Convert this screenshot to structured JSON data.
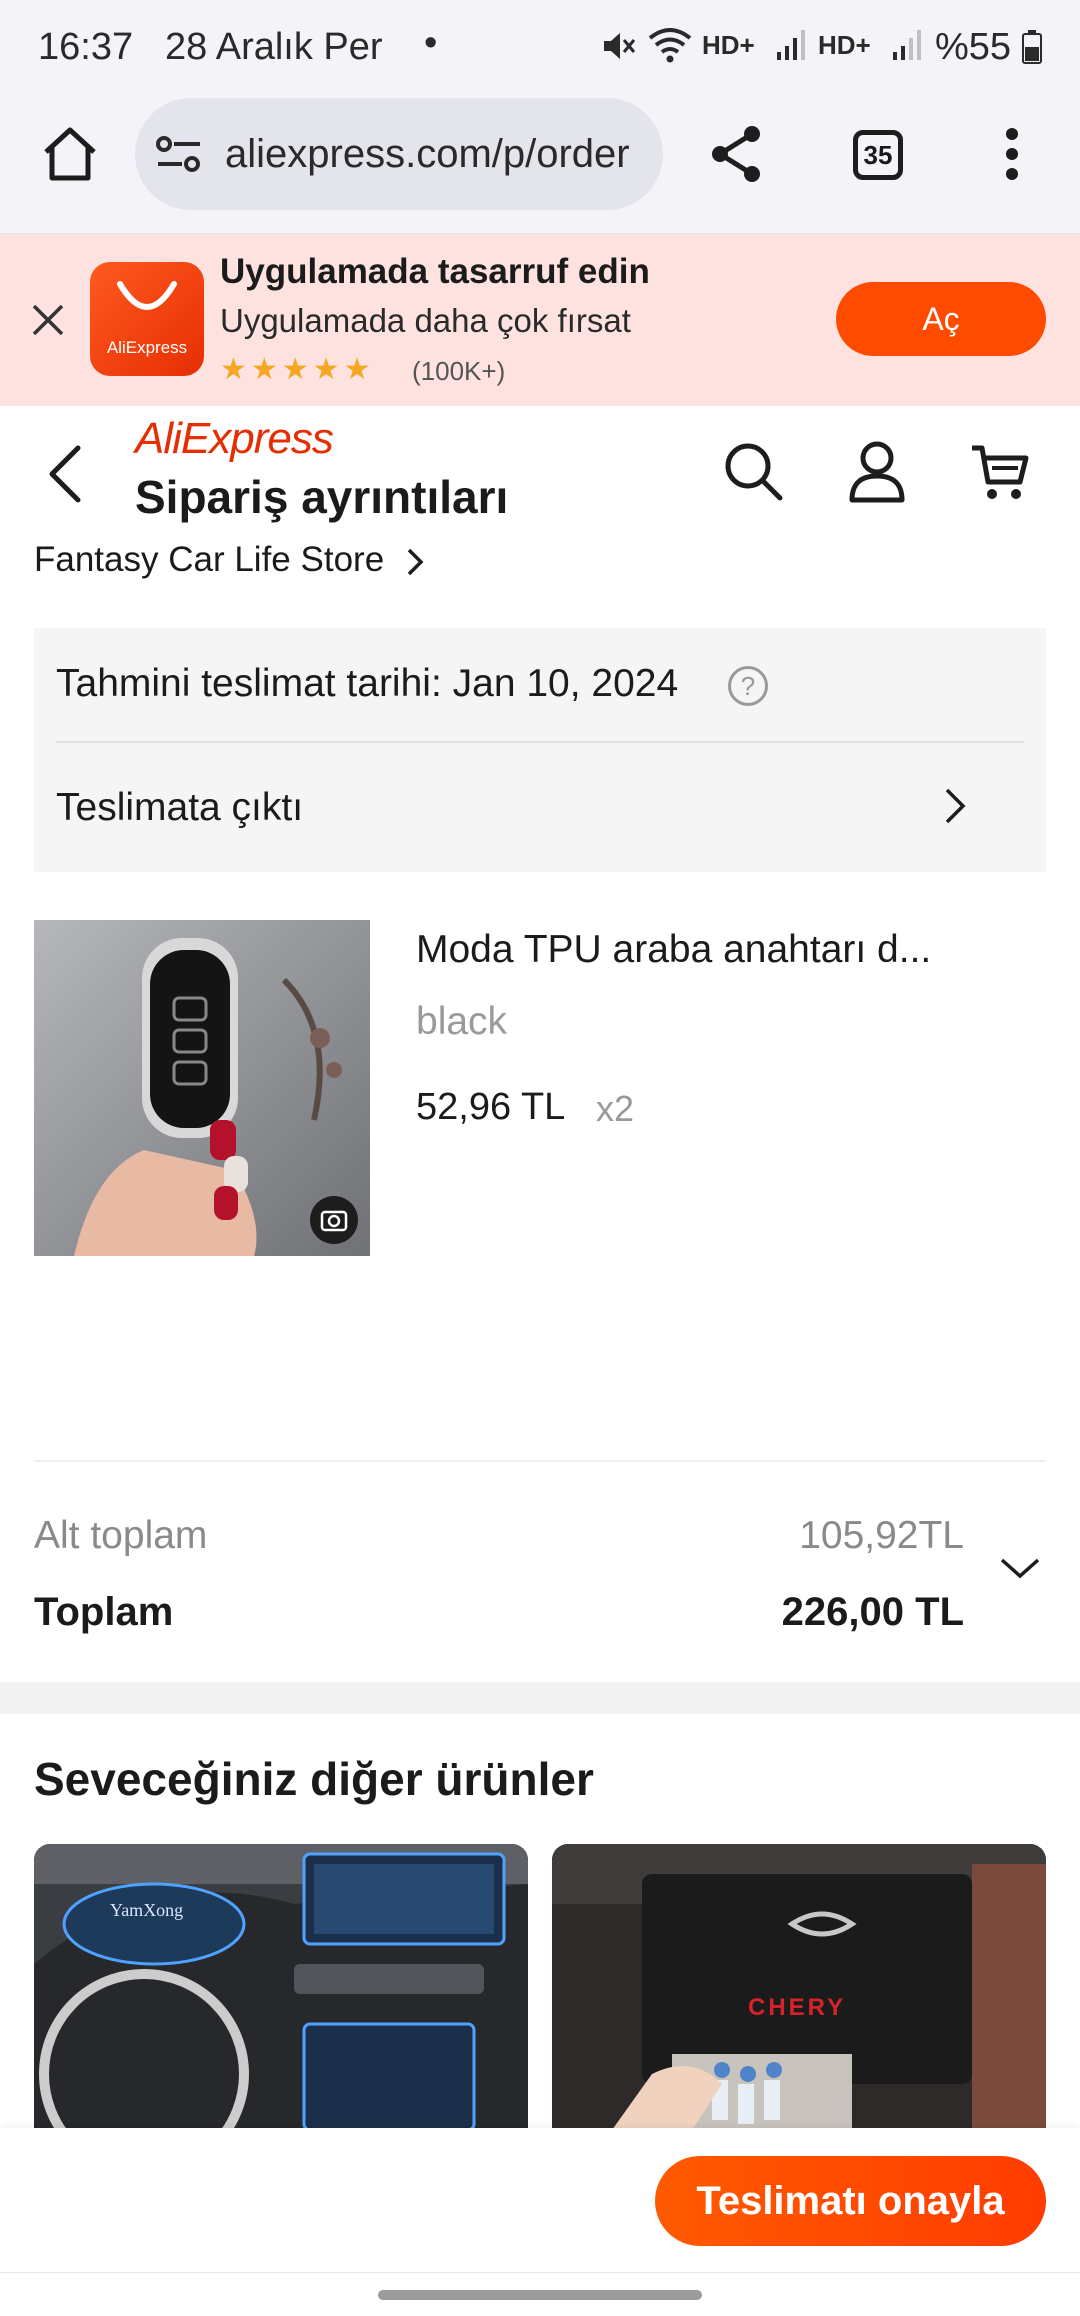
{
  "status_bar": {
    "time": "16:37",
    "date": "28 Aralık Per",
    "dot": "•",
    "network_1": "HD+",
    "network_2": "HD+",
    "battery": "%55"
  },
  "browser": {
    "url": "aliexpress.com/p/order",
    "tab_count": "35"
  },
  "app_banner": {
    "title": "Uygulamada tasarruf edin",
    "subtitle": "Uygulamada daha çok fırsat",
    "stars": "★★★★★",
    "rating_count": "(100K+)",
    "logo_label": "AliExpress",
    "open_label": "Aç"
  },
  "header": {
    "logo": "AliExpress",
    "title": "Sipariş ayrıntıları",
    "store_name": "Fantasy Car Life Store"
  },
  "delivery": {
    "estimated_date": "Tahmini teslimat tarihi: Jan 10, 2024",
    "help": "?",
    "status": "Teslimata çıktı"
  },
  "product": {
    "name": "Moda TPU araba anahtarı d...",
    "variant": "black",
    "price": "52,96 TL",
    "quantity": "x2"
  },
  "totals": {
    "subtotal_label": "Alt toplam",
    "subtotal_value": "105,92TL",
    "total_label": "Toplam",
    "total_value": "226,00 TL"
  },
  "recommendations": {
    "title": "Seveceğiniz diğer ürünler",
    "card_1_watermark": "YamXong",
    "card_2_brand": "CHERY"
  },
  "actions": {
    "confirm_delivery": "Teslimatı onayla"
  },
  "colors": {
    "brand": "#e62e04",
    "cta": "#ff4b00",
    "banner_bg": "#fde2e0",
    "card_bg": "#f5f5f5"
  }
}
